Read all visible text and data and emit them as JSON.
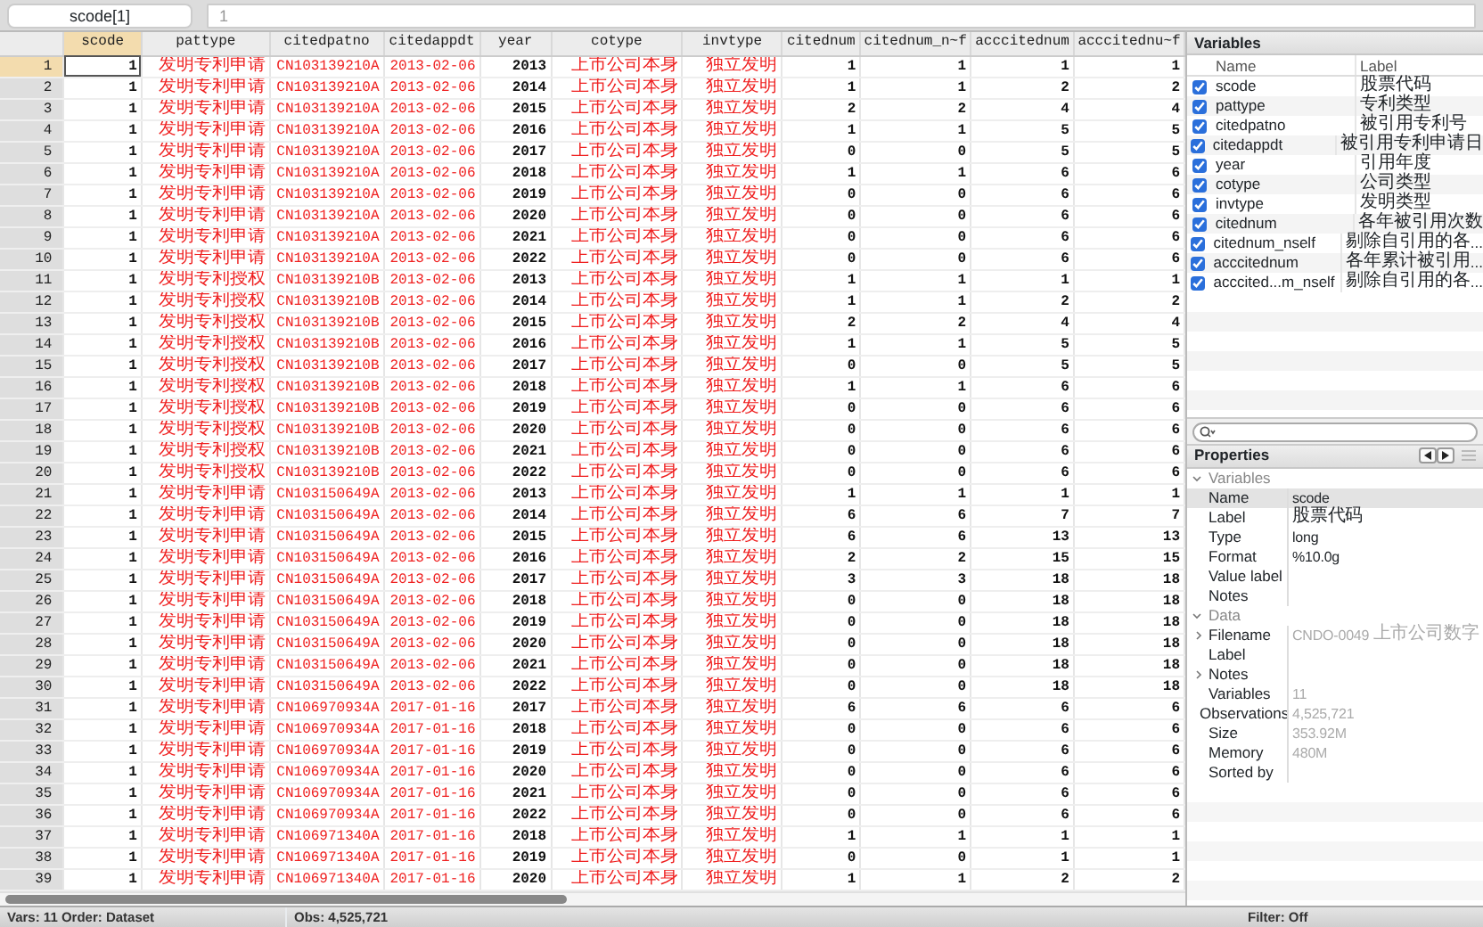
{
  "toolbar": {
    "variable_field": "scode[1]",
    "value_field": "1"
  },
  "table": {
    "columns": [
      {
        "label": "scode",
        "kind": "numeric",
        "selected": true
      },
      {
        "label": "pattype",
        "kind": "string",
        "selected": false
      },
      {
        "label": "citedpatno",
        "kind": "string",
        "selected": false
      },
      {
        "label": "citedappdt",
        "kind": "string",
        "selected": false
      },
      {
        "label": "year",
        "kind": "numeric",
        "selected": false
      },
      {
        "label": "cotype",
        "kind": "string",
        "selected": false
      },
      {
        "label": "invtype",
        "kind": "string",
        "selected": false
      },
      {
        "label": "citednum",
        "kind": "numeric",
        "selected": false
      },
      {
        "label": "citednum_n~f",
        "kind": "numeric",
        "selected": false
      },
      {
        "label": "acccitednum",
        "kind": "numeric",
        "selected": false
      },
      {
        "label": "acccitednu~f",
        "kind": "numeric",
        "selected": false
      }
    ],
    "rows": [
      {
        "number": "1",
        "selected": true,
        "cells": [
          "1",
          "发明专利申请",
          "CN103139210A",
          "2013-02-06",
          "2013",
          "上市公司本身",
          "独立发明",
          "1",
          "1",
          "1",
          "1"
        ]
      },
      {
        "number": "2",
        "selected": false,
        "cells": [
          "1",
          "发明专利申请",
          "CN103139210A",
          "2013-02-06",
          "2014",
          "上市公司本身",
          "独立发明",
          "1",
          "1",
          "2",
          "2"
        ]
      },
      {
        "number": "3",
        "selected": false,
        "cells": [
          "1",
          "发明专利申请",
          "CN103139210A",
          "2013-02-06",
          "2015",
          "上市公司本身",
          "独立发明",
          "2",
          "2",
          "4",
          "4"
        ]
      },
      {
        "number": "4",
        "selected": false,
        "cells": [
          "1",
          "发明专利申请",
          "CN103139210A",
          "2013-02-06",
          "2016",
          "上市公司本身",
          "独立发明",
          "1",
          "1",
          "5",
          "5"
        ]
      },
      {
        "number": "5",
        "selected": false,
        "cells": [
          "1",
          "发明专利申请",
          "CN103139210A",
          "2013-02-06",
          "2017",
          "上市公司本身",
          "独立发明",
          "0",
          "0",
          "5",
          "5"
        ]
      },
      {
        "number": "6",
        "selected": false,
        "cells": [
          "1",
          "发明专利申请",
          "CN103139210A",
          "2013-02-06",
          "2018",
          "上市公司本身",
          "独立发明",
          "1",
          "1",
          "6",
          "6"
        ]
      },
      {
        "number": "7",
        "selected": false,
        "cells": [
          "1",
          "发明专利申请",
          "CN103139210A",
          "2013-02-06",
          "2019",
          "上市公司本身",
          "独立发明",
          "0",
          "0",
          "6",
          "6"
        ]
      },
      {
        "number": "8",
        "selected": false,
        "cells": [
          "1",
          "发明专利申请",
          "CN103139210A",
          "2013-02-06",
          "2020",
          "上市公司本身",
          "独立发明",
          "0",
          "0",
          "6",
          "6"
        ]
      },
      {
        "number": "9",
        "selected": false,
        "cells": [
          "1",
          "发明专利申请",
          "CN103139210A",
          "2013-02-06",
          "2021",
          "上市公司本身",
          "独立发明",
          "0",
          "0",
          "6",
          "6"
        ]
      },
      {
        "number": "10",
        "selected": false,
        "cells": [
          "1",
          "发明专利申请",
          "CN103139210A",
          "2013-02-06",
          "2022",
          "上市公司本身",
          "独立发明",
          "0",
          "0",
          "6",
          "6"
        ]
      },
      {
        "number": "11",
        "selected": false,
        "cells": [
          "1",
          "发明专利授权",
          "CN103139210B",
          "2013-02-06",
          "2013",
          "上市公司本身",
          "独立发明",
          "1",
          "1",
          "1",
          "1"
        ]
      },
      {
        "number": "12",
        "selected": false,
        "cells": [
          "1",
          "发明专利授权",
          "CN103139210B",
          "2013-02-06",
          "2014",
          "上市公司本身",
          "独立发明",
          "1",
          "1",
          "2",
          "2"
        ]
      },
      {
        "number": "13",
        "selected": false,
        "cells": [
          "1",
          "发明专利授权",
          "CN103139210B",
          "2013-02-06",
          "2015",
          "上市公司本身",
          "独立发明",
          "2",
          "2",
          "4",
          "4"
        ]
      },
      {
        "number": "14",
        "selected": false,
        "cells": [
          "1",
          "发明专利授权",
          "CN103139210B",
          "2013-02-06",
          "2016",
          "上市公司本身",
          "独立发明",
          "1",
          "1",
          "5",
          "5"
        ]
      },
      {
        "number": "15",
        "selected": false,
        "cells": [
          "1",
          "发明专利授权",
          "CN103139210B",
          "2013-02-06",
          "2017",
          "上市公司本身",
          "独立发明",
          "0",
          "0",
          "5",
          "5"
        ]
      },
      {
        "number": "16",
        "selected": false,
        "cells": [
          "1",
          "发明专利授权",
          "CN103139210B",
          "2013-02-06",
          "2018",
          "上市公司本身",
          "独立发明",
          "1",
          "1",
          "6",
          "6"
        ]
      },
      {
        "number": "17",
        "selected": false,
        "cells": [
          "1",
          "发明专利授权",
          "CN103139210B",
          "2013-02-06",
          "2019",
          "上市公司本身",
          "独立发明",
          "0",
          "0",
          "6",
          "6"
        ]
      },
      {
        "number": "18",
        "selected": false,
        "cells": [
          "1",
          "发明专利授权",
          "CN103139210B",
          "2013-02-06",
          "2020",
          "上市公司本身",
          "独立发明",
          "0",
          "0",
          "6",
          "6"
        ]
      },
      {
        "number": "19",
        "selected": false,
        "cells": [
          "1",
          "发明专利授权",
          "CN103139210B",
          "2013-02-06",
          "2021",
          "上市公司本身",
          "独立发明",
          "0",
          "0",
          "6",
          "6"
        ]
      },
      {
        "number": "20",
        "selected": false,
        "cells": [
          "1",
          "发明专利授权",
          "CN103139210B",
          "2013-02-06",
          "2022",
          "上市公司本身",
          "独立发明",
          "0",
          "0",
          "6",
          "6"
        ]
      },
      {
        "number": "21",
        "selected": false,
        "cells": [
          "1",
          "发明专利申请",
          "CN103150649A",
          "2013-02-06",
          "2013",
          "上市公司本身",
          "独立发明",
          "1",
          "1",
          "1",
          "1"
        ]
      },
      {
        "number": "22",
        "selected": false,
        "cells": [
          "1",
          "发明专利申请",
          "CN103150649A",
          "2013-02-06",
          "2014",
          "上市公司本身",
          "独立发明",
          "6",
          "6",
          "7",
          "7"
        ]
      },
      {
        "number": "23",
        "selected": false,
        "cells": [
          "1",
          "发明专利申请",
          "CN103150649A",
          "2013-02-06",
          "2015",
          "上市公司本身",
          "独立发明",
          "6",
          "6",
          "13",
          "13"
        ]
      },
      {
        "number": "24",
        "selected": false,
        "cells": [
          "1",
          "发明专利申请",
          "CN103150649A",
          "2013-02-06",
          "2016",
          "上市公司本身",
          "独立发明",
          "2",
          "2",
          "15",
          "15"
        ]
      },
      {
        "number": "25",
        "selected": false,
        "cells": [
          "1",
          "发明专利申请",
          "CN103150649A",
          "2013-02-06",
          "2017",
          "上市公司本身",
          "独立发明",
          "3",
          "3",
          "18",
          "18"
        ]
      },
      {
        "number": "26",
        "selected": false,
        "cells": [
          "1",
          "发明专利申请",
          "CN103150649A",
          "2013-02-06",
          "2018",
          "上市公司本身",
          "独立发明",
          "0",
          "0",
          "18",
          "18"
        ]
      },
      {
        "number": "27",
        "selected": false,
        "cells": [
          "1",
          "发明专利申请",
          "CN103150649A",
          "2013-02-06",
          "2019",
          "上市公司本身",
          "独立发明",
          "0",
          "0",
          "18",
          "18"
        ]
      },
      {
        "number": "28",
        "selected": false,
        "cells": [
          "1",
          "发明专利申请",
          "CN103150649A",
          "2013-02-06",
          "2020",
          "上市公司本身",
          "独立发明",
          "0",
          "0",
          "18",
          "18"
        ]
      },
      {
        "number": "29",
        "selected": false,
        "cells": [
          "1",
          "发明专利申请",
          "CN103150649A",
          "2013-02-06",
          "2021",
          "上市公司本身",
          "独立发明",
          "0",
          "0",
          "18",
          "18"
        ]
      },
      {
        "number": "30",
        "selected": false,
        "cells": [
          "1",
          "发明专利申请",
          "CN103150649A",
          "2013-02-06",
          "2022",
          "上市公司本身",
          "独立发明",
          "0",
          "0",
          "18",
          "18"
        ]
      },
      {
        "number": "31",
        "selected": false,
        "cells": [
          "1",
          "发明专利申请",
          "CN106970934A",
          "2017-01-16",
          "2017",
          "上市公司本身",
          "独立发明",
          "6",
          "6",
          "6",
          "6"
        ]
      },
      {
        "number": "32",
        "selected": false,
        "cells": [
          "1",
          "发明专利申请",
          "CN106970934A",
          "2017-01-16",
          "2018",
          "上市公司本身",
          "独立发明",
          "0",
          "0",
          "6",
          "6"
        ]
      },
      {
        "number": "33",
        "selected": false,
        "cells": [
          "1",
          "发明专利申请",
          "CN106970934A",
          "2017-01-16",
          "2019",
          "上市公司本身",
          "独立发明",
          "0",
          "0",
          "6",
          "6"
        ]
      },
      {
        "number": "34",
        "selected": false,
        "cells": [
          "1",
          "发明专利申请",
          "CN106970934A",
          "2017-01-16",
          "2020",
          "上市公司本身",
          "独立发明",
          "0",
          "0",
          "6",
          "6"
        ]
      },
      {
        "number": "35",
        "selected": false,
        "cells": [
          "1",
          "发明专利申请",
          "CN106970934A",
          "2017-01-16",
          "2021",
          "上市公司本身",
          "独立发明",
          "0",
          "0",
          "6",
          "6"
        ]
      },
      {
        "number": "36",
        "selected": false,
        "cells": [
          "1",
          "发明专利申请",
          "CN106970934A",
          "2017-01-16",
          "2022",
          "上市公司本身",
          "独立发明",
          "0",
          "0",
          "6",
          "6"
        ]
      },
      {
        "number": "37",
        "selected": false,
        "cells": [
          "1",
          "发明专利申请",
          "CN106971340A",
          "2017-01-16",
          "2018",
          "上市公司本身",
          "独立发明",
          "1",
          "1",
          "1",
          "1"
        ]
      },
      {
        "number": "38",
        "selected": false,
        "cells": [
          "1",
          "发明专利申请",
          "CN106971340A",
          "2017-01-16",
          "2019",
          "上市公司本身",
          "独立发明",
          "0",
          "0",
          "1",
          "1"
        ]
      },
      {
        "number": "39",
        "selected": false,
        "cells": [
          "1",
          "发明专利申请",
          "CN106971340A",
          "2017-01-16",
          "2020",
          "上市公司本身",
          "独立发明",
          "1",
          "1",
          "2",
          "2"
        ]
      }
    ]
  },
  "variables": {
    "title": "Variables",
    "columns": [
      "Name",
      "Label"
    ],
    "items": [
      {
        "name": "scode",
        "label": "股票代码",
        "checked": true
      },
      {
        "name": "pattype",
        "label": "专利类型",
        "checked": true
      },
      {
        "name": "citedpatno",
        "label": "被引用专利号",
        "checked": true
      },
      {
        "name": "citedappdt",
        "label": "被引用专利申请日",
        "checked": true
      },
      {
        "name": "year",
        "label": "引用年度",
        "checked": true
      },
      {
        "name": "cotype",
        "label": "公司类型",
        "checked": true
      },
      {
        "name": "invtype",
        "label": "发明类型",
        "checked": true
      },
      {
        "name": "citednum",
        "label": "各年被引用次数",
        "checked": true
      },
      {
        "name": "citednum_nself",
        "label": "剔除自引用的各...",
        "checked": true
      },
      {
        "name": "acccitednum",
        "label": "各年累计被引用...",
        "checked": true
      },
      {
        "name": "acccited...m_nself",
        "label": "剔除自引用的各...",
        "checked": true
      }
    ]
  },
  "properties": {
    "title": "Properties",
    "sections": [
      {
        "title": "Variables",
        "expanded": true,
        "items": [
          {
            "name": "Name",
            "value": "scode",
            "selected": true,
            "dimmed": false
          },
          {
            "name": "Label",
            "value": "股票代码",
            "selected": false,
            "dimmed": false
          },
          {
            "name": "Type",
            "value": "long",
            "selected": false,
            "dimmed": false
          },
          {
            "name": "Format",
            "value": "%10.0g",
            "selected": false,
            "dimmed": false
          },
          {
            "name": "Value label",
            "selected": false
          },
          {
            "name": "Notes",
            "selected": false
          }
        ]
      },
      {
        "title": "Data",
        "expanded": true,
        "items": [
          {
            "name": "Filename",
            "value": "CNDO-0049 上市公司数字",
            "expanded": false,
            "selected": false,
            "dimmed": true
          },
          {
            "name": "Label",
            "selected": false
          },
          {
            "name": "Notes",
            "expanded": false,
            "selected": false
          },
          {
            "name": "Variables",
            "value": "11",
            "selected": false,
            "dimmed": true
          },
          {
            "name": "Observations",
            "value": "4,525,721",
            "selected": false,
            "dimmed": true
          },
          {
            "name": "Size",
            "value": "353.92M",
            "selected": false,
            "dimmed": true
          },
          {
            "name": "Memory",
            "value": "480M",
            "selected": false,
            "dimmed": true
          },
          {
            "name": "Sorted by",
            "selected": false
          }
        ]
      }
    ]
  },
  "status_bar": {
    "vars_order": "Vars: 11  Order: Dataset",
    "observations": "Obs: 4,525,721",
    "filter": "Filter: Off"
  }
}
